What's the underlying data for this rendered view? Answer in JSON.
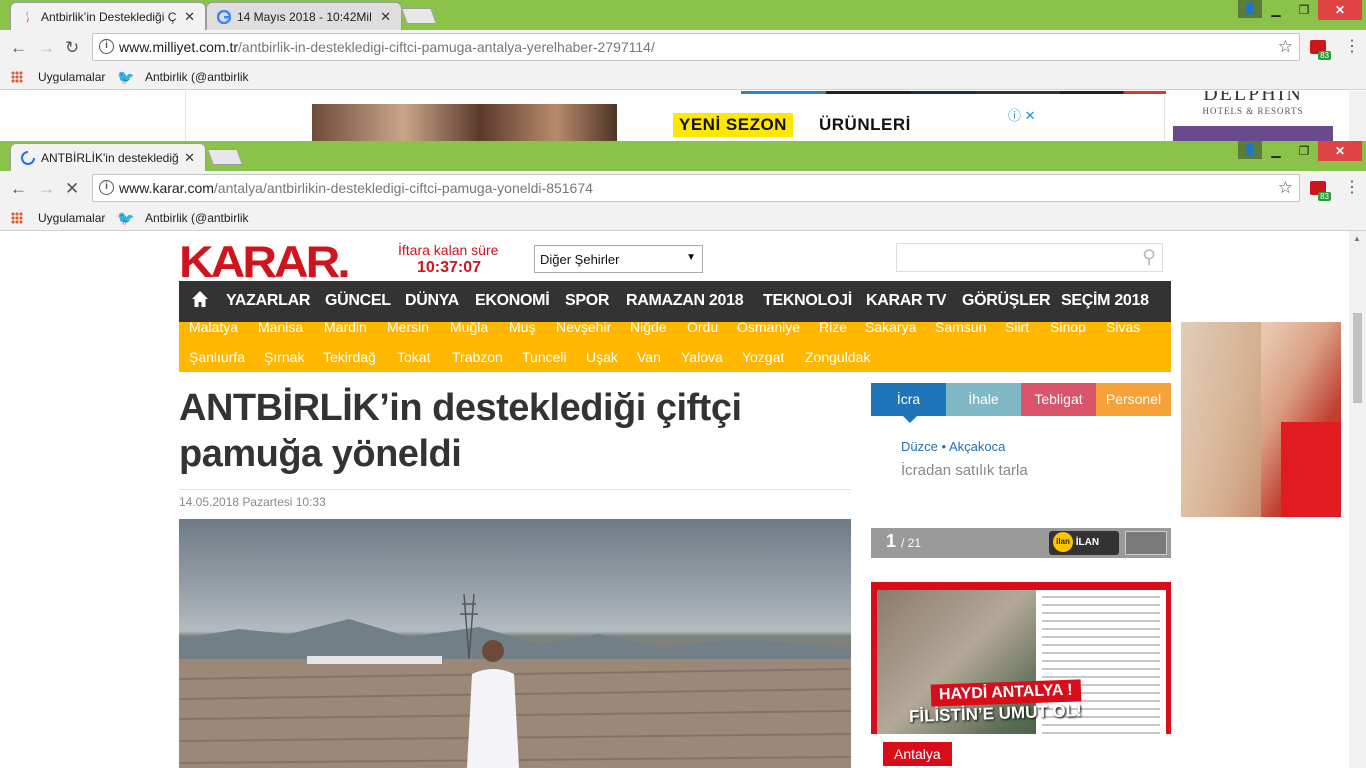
{
  "back_window": {
    "tabs": [
      {
        "title": "Antbirlik’in Desteklediği Ç",
        "active": true
      },
      {
        "title": "14 Mayıs 2018 - 10:42Mil",
        "active": false
      }
    ],
    "url_host": "www.milliyet.com.tr",
    "url_path": "/antbirlik-in-destekledigi-ciftci-pamuga-antalya-yerelhaber-2797114/",
    "bookmarks": [
      "Uygulamalar",
      "Antbirlik (@antbirlik"
    ],
    "ad": {
      "text1": "YENİ SEZON",
      "text2": "ÜRÜNLERİ",
      "brand": "DELPHIN",
      "brand_sub": "HOTELS & RESORTS"
    },
    "ext_badge": "83"
  },
  "front_window": {
    "tab_title": "ANTBİRLİK'in desteklediğ",
    "url_host": "www.karar.com",
    "url_path": "/antalya/antbirlikin-destekledigi-ciftci-pamuga-yoneldi-851674",
    "bookmarks": [
      "Uygulamalar",
      "Antbirlik (@antbirlik"
    ],
    "ext_badge": "83"
  },
  "site": {
    "logo": "KARAR.",
    "iftar_label": "İftara kalan süre",
    "iftar_time": "10:37:07",
    "city_select": "Diğer Şehirler",
    "nav": [
      "YAZARLAR",
      "GÜNCEL",
      "DÜNYA",
      "EKONOMİ",
      "SPOR",
      "RAMAZAN 2018",
      "TEKNOLOJİ",
      "KARAR TV",
      "GÖRÜŞLER",
      "SEÇİM 2018"
    ],
    "cities_row1": [
      "Malatya",
      "Manisa",
      "Mardin",
      "Mersin",
      "Muğla",
      "Muş",
      "Nevşehir",
      "Niğde",
      "Ordu",
      "Osmaniye",
      "Rize",
      "Sakarya",
      "Samsun",
      "Siirt",
      "Sinop",
      "Sivas"
    ],
    "cities_row2": [
      "Şanlıurfa",
      "Şırnak",
      "Tekirdağ",
      "Tokat",
      "Trabzon",
      "Tunceli",
      "Uşak",
      "Van",
      "Yalova",
      "Yozgat",
      "Zonguldak"
    ]
  },
  "article": {
    "title_line1": "ANTBİRLİK’in desteklediği çiftçi",
    "title_line2": "pamuğa yöneldi",
    "date": "14.05.2018 Pazartesi 10:33"
  },
  "ilan": {
    "tabs": [
      {
        "label": "İcra",
        "color": "#1f73b7"
      },
      {
        "label": "İhale",
        "color": "#7fb8c4"
      },
      {
        "label": "Tebligat",
        "color": "#d9536b"
      },
      {
        "label": "Personel",
        "color": "#f5a23a"
      }
    ],
    "city": "Düzce",
    "town": "Akçakoca",
    "sep": "•",
    "title": "İcradan satılık tarla",
    "page_current": "1",
    "page_total": "/ 21",
    "logo_text": "İLAN GOV.TR"
  },
  "ad_side": {
    "haydi": "HAYDİ ANTALYA !",
    "filistin": "FİLİSTİN’E UMUT OL!",
    "tag": "Antalya"
  }
}
